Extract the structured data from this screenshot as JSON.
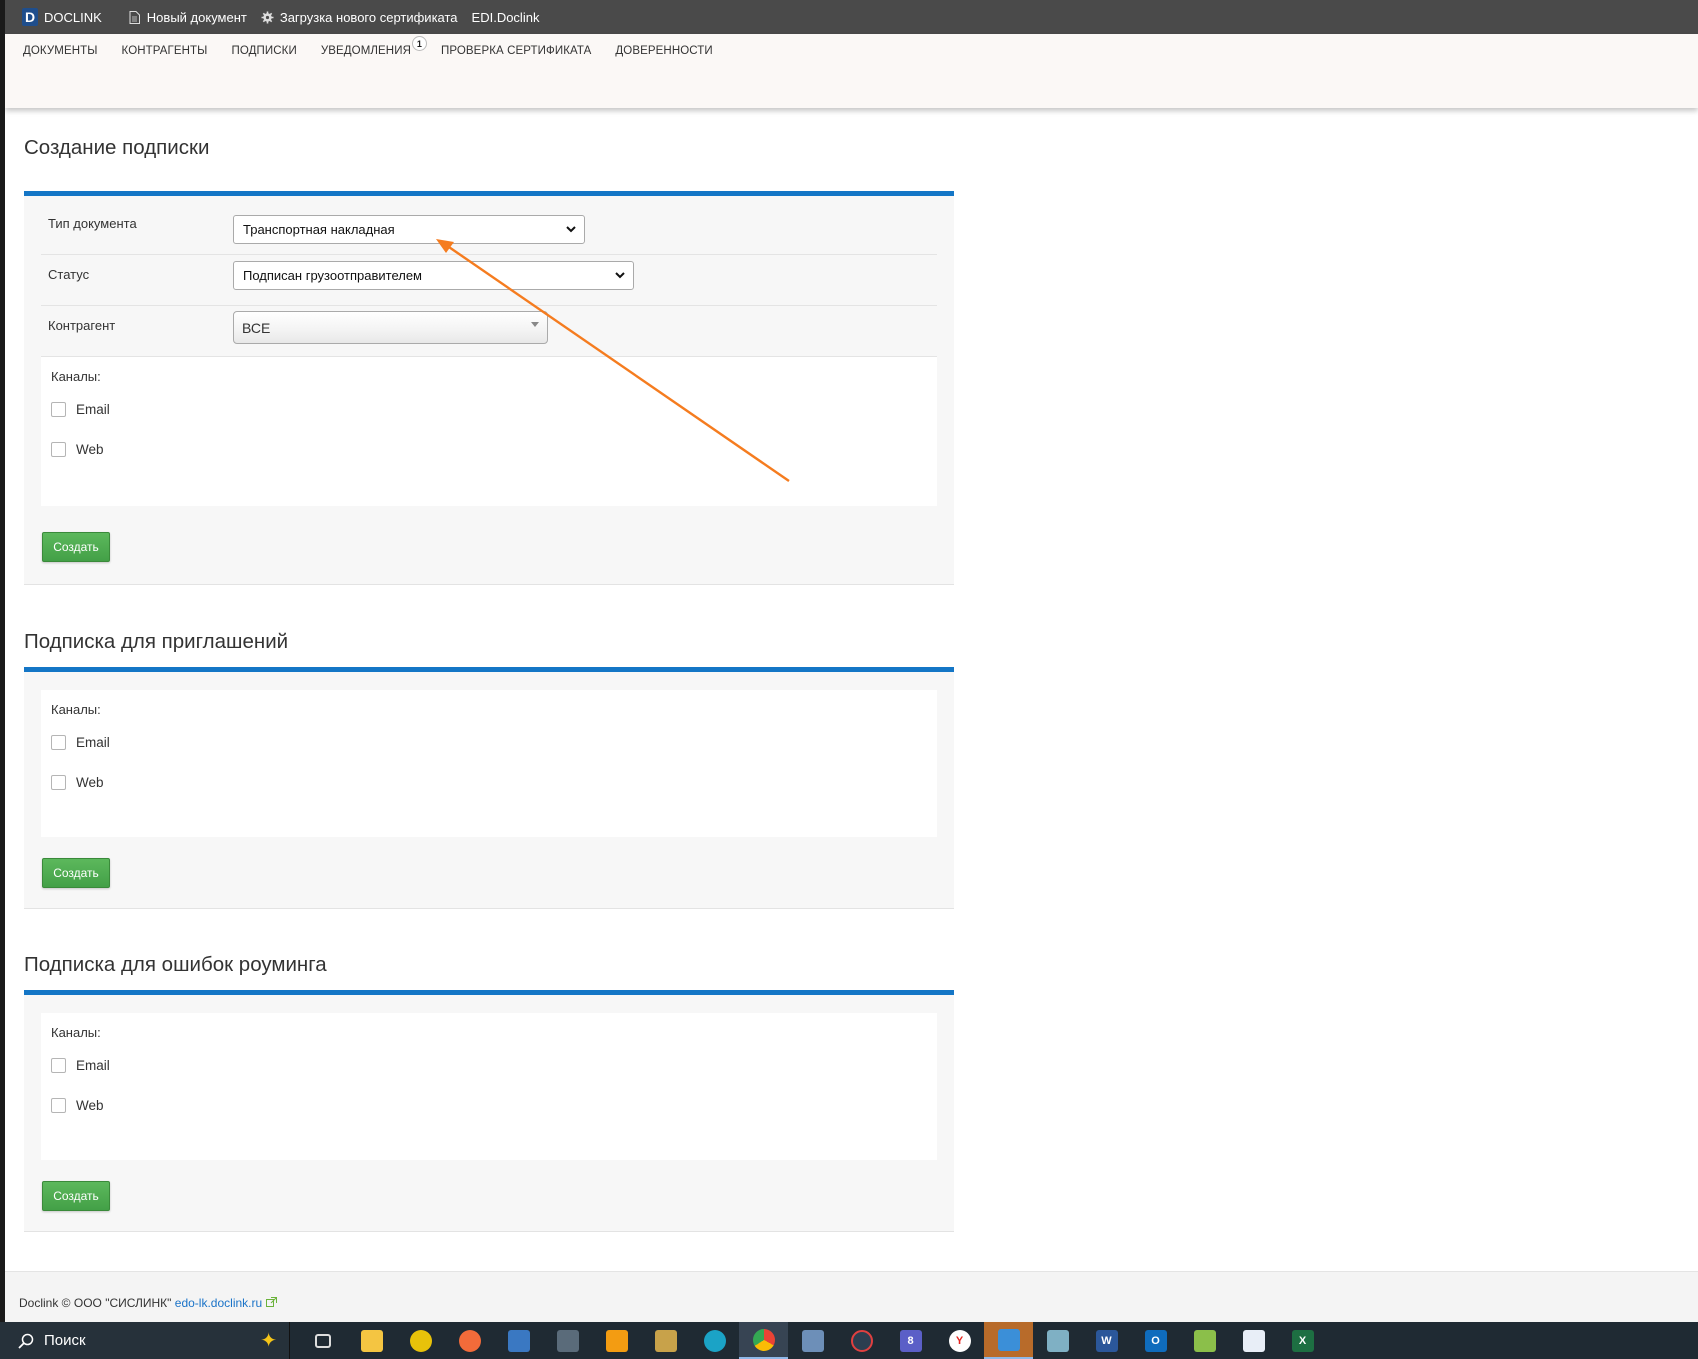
{
  "topbar": {
    "brand": "DOCLINK",
    "logo_letter": "D",
    "new_document": "Новый документ",
    "upload_cert": "Загрузка нового сертификата",
    "edi": "EDI.Doclink"
  },
  "nav": {
    "documents": "ДОКУМЕНТЫ",
    "contractors": "КОНТРАГЕНТЫ",
    "subscriptions": "ПОДПИСКИ",
    "notifications": "УВЕДОМЛЕНИЯ",
    "notifications_badge": "1",
    "cert_check": "ПРОВЕРКА СЕРТИФИКАТА",
    "powers": "ДОВЕРЕННОСТИ"
  },
  "create_subscription": {
    "title": "Создание подписки",
    "doc_type_label": "Тип документа",
    "doc_type_value": "Транспортная накладная",
    "status_label": "Статус",
    "status_value": "Подписан грузоотправителем",
    "contractor_label": "Контрагент",
    "contractor_value": "ВСЕ",
    "channels_label": "Каналы:",
    "email": "Email",
    "web": "Web",
    "create_button": "Создать"
  },
  "invitations": {
    "title": "Подписка для приглашений",
    "channels_label": "Каналы:",
    "email": "Email",
    "web": "Web",
    "create_button": "Создать"
  },
  "roaming": {
    "title": "Подписка для ошибок роуминга",
    "channels_label": "Каналы:",
    "email": "Email",
    "web": "Web",
    "create_button": "Создать"
  },
  "footer": {
    "copyright": "Doclink © ООО \"СИСЛИНК\"",
    "link": "edo-lk.doclink.ru"
  },
  "taskbar": {
    "search": "Поиск",
    "teams_badge": "8"
  },
  "colors": {
    "accent_blue": "#1476c6",
    "button_green": "#4cae4c",
    "annotation_arrow": "#f57c1f"
  }
}
